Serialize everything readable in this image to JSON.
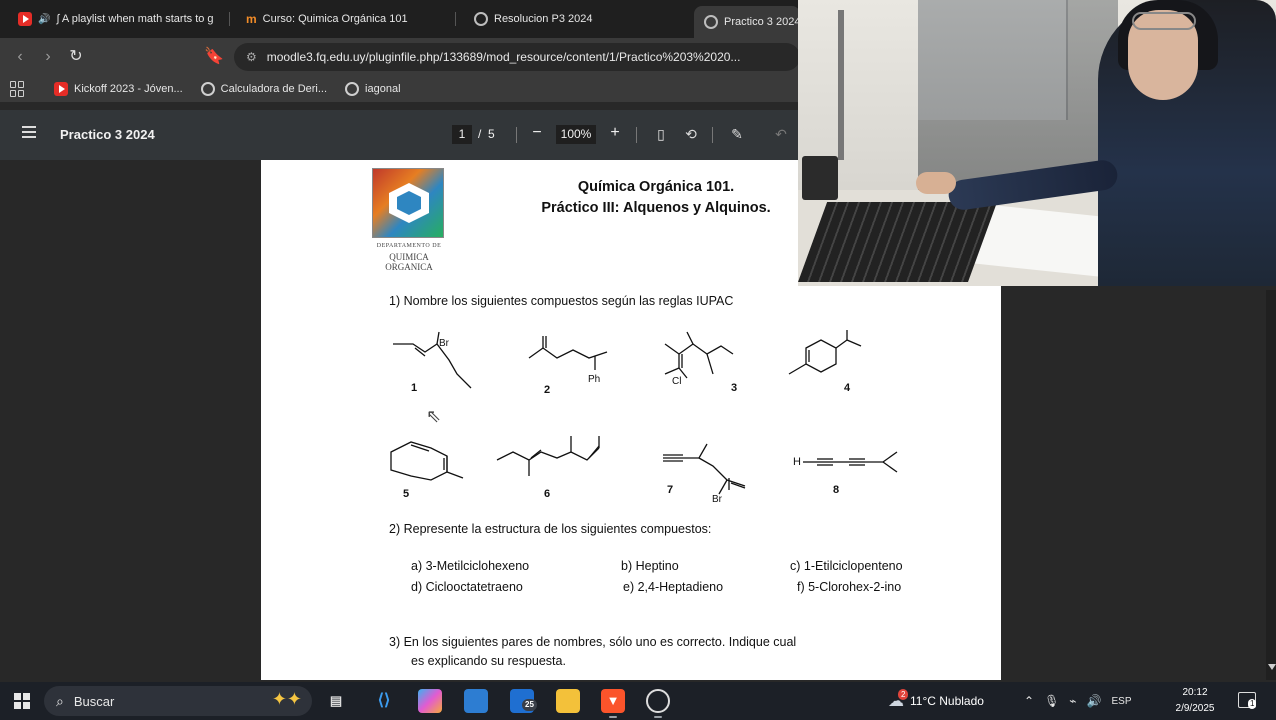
{
  "browser": {
    "tabs": [
      {
        "label": "∫ A playlist when math starts to g",
        "favicon": "youtube-icon",
        "active": false
      },
      {
        "label": "Curso: Quimica Orgánica 101",
        "favicon": "moodle-icon",
        "active": false
      },
      {
        "label": "Resolucion P3 2024",
        "favicon": "globe-icon",
        "active": false
      },
      {
        "label": "Practico 3 2024",
        "favicon": "globe-icon",
        "active": true
      }
    ],
    "url": "moodle3.fq.edu.uy/pluginfile.php/133689/mod_resource/content/1/Practico%203%2020...",
    "bookmarks": [
      {
        "label": "Kickoff 2023 - Jóven...",
        "favicon": "youtube-icon"
      },
      {
        "label": "Calculadora de Deri...",
        "favicon": "calculator-icon"
      },
      {
        "label": "iagonal",
        "favicon": "globe-icon"
      }
    ]
  },
  "pdf_viewer": {
    "title": "Practico 3 2024",
    "current_page": "1",
    "page_separator": "/",
    "total_pages": "5",
    "zoom": "100%"
  },
  "document": {
    "logo_caption_small": "DEPARTAMENTO DE",
    "logo_caption": "QUIMICA ORGANICA",
    "heading_1": "Química Orgánica 101.",
    "heading_2": "Práctico III: Alquenos y Alquinos.",
    "question_1": "1)   Nombre los siguientes compuestos según las reglas IUPAC",
    "structure_labels": [
      "1",
      "2",
      "3",
      "4",
      "5",
      "6",
      "7",
      "8"
    ],
    "atom_labels": {
      "br": "Br",
      "ph": "Ph",
      "cl": "Cl",
      "h": "H"
    },
    "question_2": "2)   Represente la estructura de los siguientes compuestos:",
    "options": [
      "a)   3-Metilciclohexeno",
      "b) Heptino",
      "c) 1-Etilciclopenteno",
      "d)    Ciclooctatetraeno",
      "e) 2,4-Heptadieno",
      "f) 5-Clorohex-2-ino"
    ],
    "question_3_line1": "3)    En los siguientes pares de nombres, sólo uno es correcto. Indique cual",
    "question_3_line2": "es explicando su respuesta."
  },
  "taskbar": {
    "search_placeholder": "Buscar",
    "pinned": [
      "task-view-icon",
      "vscode-icon",
      "copilot-icon",
      "store-icon",
      "mail-icon",
      "file-explorer-icon",
      "brave-icon",
      "obs-icon"
    ],
    "mail_badge": "25",
    "weather_badge": "2",
    "weather": "11°C  Nublado",
    "language": "ESP",
    "time": "20:12",
    "date": "2/9/2025",
    "notification_count": "1"
  },
  "colors": {
    "tab_strip": "#1f1f1f",
    "toolbar": "#3a3a3a",
    "pdf_toolbar": "#323639",
    "viewer_bg": "#282828",
    "taskbar": "#1c2027"
  }
}
